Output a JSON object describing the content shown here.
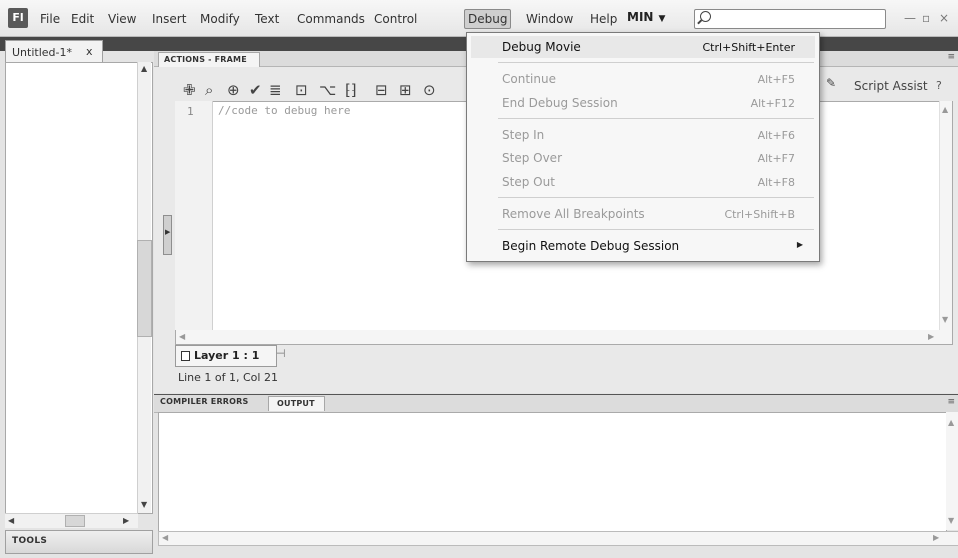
{
  "app": {
    "logo": "Fl"
  },
  "menubar": {
    "items": [
      "File",
      "Edit",
      "View",
      "Insert",
      "Modify",
      "Text",
      "Commands",
      "Control",
      "Debug",
      "Window",
      "Help"
    ],
    "workspace": "MIN",
    "search_placeholder": "",
    "window_controls": {
      "minimize": "—",
      "restore": "▫",
      "close": "×"
    }
  },
  "document": {
    "tab_label": "Untitled-1*",
    "tab_close": "x"
  },
  "tools_panel": {
    "label": "TOOLS"
  },
  "actions_panel": {
    "tab_label": "ACTIONS - FRAME",
    "toolbar_icons": [
      "add-statement-icon",
      "find-icon",
      "insert-target-path-icon",
      "check-syntax-icon",
      "auto-format-icon",
      "show-code-hint-icon",
      "debug-options-icon",
      "collapse-between-braces-icon",
      "collapse-selection-icon",
      "expand-all-icon",
      "apply-block-comment-icon"
    ],
    "toolbar_glyphs": [
      "✙",
      "⌕",
      "⊕",
      "✔",
      "≣",
      "⊡",
      "⌥",
      "⁅⁆",
      "⊟",
      "⊞",
      "⊙"
    ],
    "script_assist": "Script Assist",
    "help": "?",
    "editor": {
      "line_number": "1",
      "code": "//code to debug here"
    },
    "layer_tab": "Layer 1 : 1",
    "status": "Line 1 of 1, Col 21"
  },
  "output_panel": {
    "tabs": [
      "COMPILER ERRORS",
      "OUTPUT"
    ],
    "active_tab": "OUTPUT"
  },
  "debug_menu": {
    "items": [
      {
        "label": "Debug Movie",
        "shortcut": "Ctrl+Shift+Enter",
        "enabled": true,
        "highlighted": true
      },
      {
        "label": "Continue",
        "shortcut": "Alt+F5",
        "enabled": false
      },
      {
        "label": "End Debug Session",
        "shortcut": "Alt+F12",
        "enabled": false
      },
      {
        "label": "Step In",
        "shortcut": "Alt+F6",
        "enabled": false
      },
      {
        "label": "Step Over",
        "shortcut": "Alt+F7",
        "enabled": false
      },
      {
        "label": "Step Out",
        "shortcut": "Alt+F8",
        "enabled": false
      },
      {
        "label": "Remove All Breakpoints",
        "shortcut": "Ctrl+Shift+B",
        "enabled": false
      },
      {
        "label": "Begin Remote Debug Session",
        "shortcut": "",
        "enabled": true,
        "submenu": true
      }
    ]
  }
}
